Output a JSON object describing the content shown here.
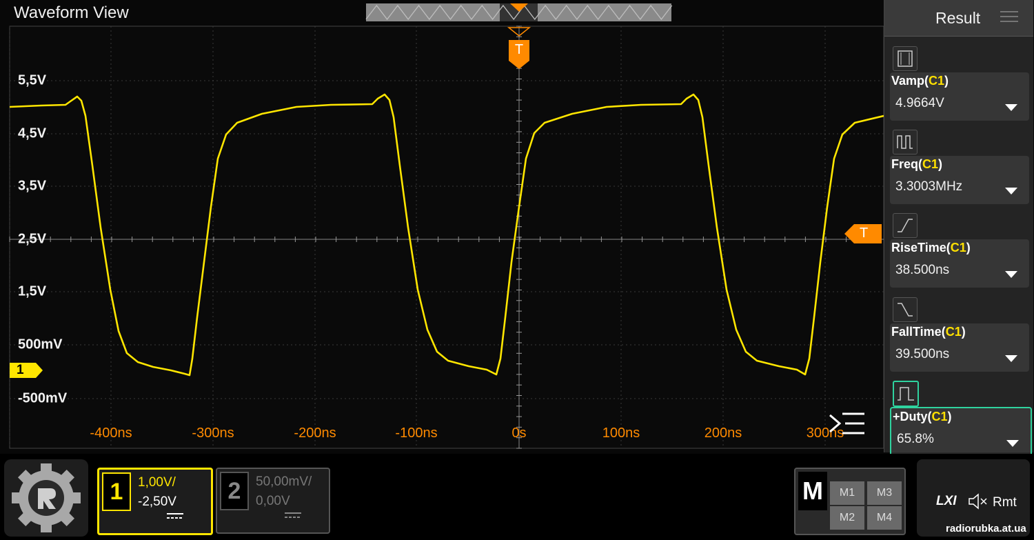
{
  "window": {
    "title": "Waveform View"
  },
  "y_axis": {
    "labels": [
      "5,5V",
      "4,5V",
      "3,5V",
      "2,5V",
      "1,5V",
      "500mV",
      "-500mV"
    ]
  },
  "x_axis": {
    "labels": [
      "-400ns",
      "-300ns",
      "-200ns",
      "-100ns",
      "0s",
      "100ns",
      "200ns",
      "300ns"
    ]
  },
  "markers": {
    "channel1": "1",
    "trigger_time": "T",
    "trigger_level": "T"
  },
  "result_panel": {
    "title": "Result",
    "measurements": [
      {
        "name": "Vamp",
        "channel": "C1",
        "value": "4.9664V",
        "icon": "amplitude-icon"
      },
      {
        "name": "Freq",
        "channel": "C1",
        "value": "3.3003MHz",
        "icon": "frequency-icon"
      },
      {
        "name": "RiseTime",
        "channel": "C1",
        "value": "38.500ns",
        "icon": "rise-time-icon"
      },
      {
        "name": "FallTime",
        "channel": "C1",
        "value": "39.500ns",
        "icon": "fall-time-icon"
      },
      {
        "name": "+Duty",
        "channel": "C1",
        "value": "65.8%",
        "icon": "duty-cycle-icon",
        "selected": true
      }
    ]
  },
  "channels": [
    {
      "number": "1",
      "scale": "1,00V/",
      "offset": "-2,50V",
      "active": true,
      "color": "#ffe600"
    },
    {
      "number": "2",
      "scale": "50,00mV/",
      "offset": "0,00V",
      "active": false,
      "color": "#888888"
    }
  ],
  "math": {
    "label": "M",
    "buttons": [
      "M1",
      "M3",
      "M2",
      "M4"
    ]
  },
  "status": {
    "lxi": "LXI",
    "remote": "Rmt"
  },
  "watermark": "radiorubka.at.ua",
  "colors": {
    "trace": "#ffe600",
    "trigger": "#ff8a00",
    "selected": "#2fd39f"
  }
}
